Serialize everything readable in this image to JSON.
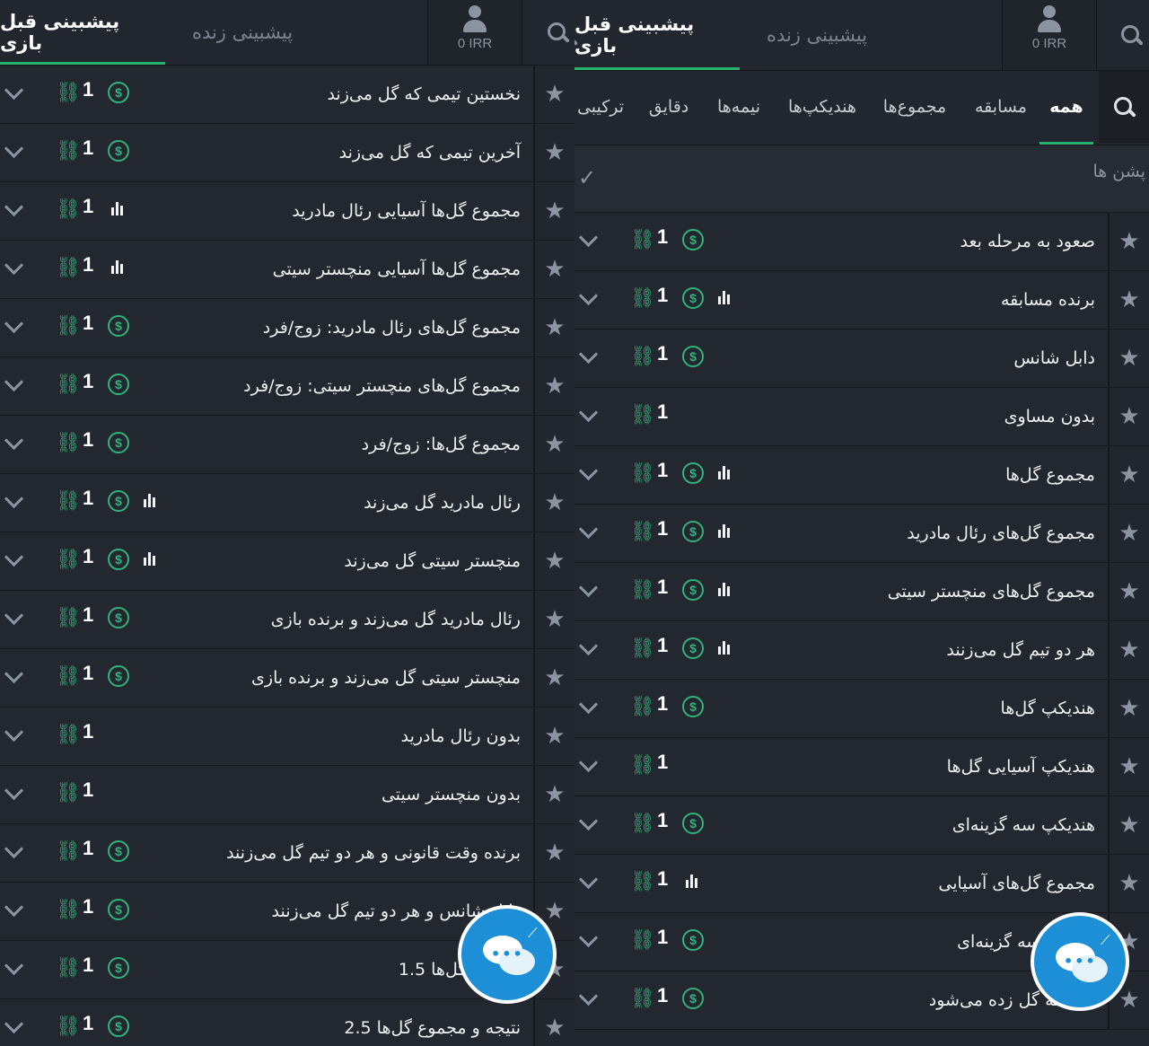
{
  "left": {
    "tabs": {
      "pre_match": "پیشبینی قبل بازی",
      "live": "پیشبینی زنده"
    },
    "wallet": {
      "balance": "0 IRR",
      "icon": "user-icon"
    },
    "rows": [
      {
        "name": "نخستین تیمی که گل می‌زند",
        "count": "1",
        "dollar": true,
        "stats": false
      },
      {
        "name": "آخرین تیمی که گل می‌زند",
        "count": "1",
        "dollar": true,
        "stats": false
      },
      {
        "name": "مجموع گل‌ها آسیایی رئال مادرید",
        "count": "1",
        "dollar": false,
        "stats": true
      },
      {
        "name": "مجموع گل‌ها آسیایی منچستر سیتی",
        "count": "1",
        "dollar": false,
        "stats": true
      },
      {
        "name": "مجموع گل‌های رئال مادرید: زوج/فرد",
        "count": "1",
        "dollar": true,
        "stats": false
      },
      {
        "name": "مجموع گل‌های منچستر سیتی: زوج/فرد",
        "count": "1",
        "dollar": true,
        "stats": false
      },
      {
        "name": "مجموع گل‌ها: زوج/فرد",
        "count": "1",
        "dollar": true,
        "stats": false
      },
      {
        "name": "رئال مادرید گل می‌زند",
        "count": "1",
        "dollar": true,
        "stats": true
      },
      {
        "name": "منچستر سیتی گل می‌زند",
        "count": "1",
        "dollar": true,
        "stats": true
      },
      {
        "name": "رئال مادرید گل می‌زند و برنده بازی",
        "count": "1",
        "dollar": true,
        "stats": false
      },
      {
        "name": "منچستر سیتی گل می‌زند و برنده بازی",
        "count": "1",
        "dollar": true,
        "stats": false
      },
      {
        "name": "بدون رئال مادرید",
        "count": "1",
        "dollar": false,
        "stats": false
      },
      {
        "name": "بدون منچستر سیتی",
        "count": "1",
        "dollar": false,
        "stats": false
      },
      {
        "name": "برنده وقت قانونی و هر دو تیم گل می‌زنند",
        "count": "1",
        "dollar": true,
        "stats": false
      },
      {
        "name": "دابل شانس و هر دو تیم گل می‌زنند",
        "count": "1",
        "dollar": true,
        "stats": false
      },
      {
        "name": "مجموع گل‌ها 1.5",
        "count": "1",
        "dollar": true,
        "stats": false
      },
      {
        "name": "نتیجه و مجموع گل‌ها 2.5",
        "count": "1",
        "dollar": true,
        "stats": false
      }
    ]
  },
  "right": {
    "tabs": {
      "pre_match": "پیشبینی قبل بازی",
      "live": "پیشبینی زنده"
    },
    "wallet": {
      "balance": "0 IRR",
      "icon": "user-icon"
    },
    "filters": [
      "همه",
      "مسابقه",
      "مجموع‌ها",
      "هندیکپ‌ها",
      "نیمه‌ها",
      "دقایق",
      "ترکیبی"
    ],
    "active_filter": "همه",
    "options_label": "پشن ها",
    "rows": [
      {
        "name": "صعود به مرحله بعد",
        "count": "1",
        "dollar": true,
        "stats": false
      },
      {
        "name": "برنده مسابقه",
        "count": "1",
        "dollar": true,
        "stats": true
      },
      {
        "name": "دابل شانس",
        "count": "1",
        "dollar": true,
        "stats": false
      },
      {
        "name": "بدون مساوی",
        "count": "1",
        "dollar": false,
        "stats": false
      },
      {
        "name": "مجموع گل‌ها",
        "count": "1",
        "dollar": true,
        "stats": true
      },
      {
        "name": "مجموع گل‌های رئال مادرید",
        "count": "1",
        "dollar": true,
        "stats": true
      },
      {
        "name": "مجموع گل‌های منچستر سیتی",
        "count": "1",
        "dollar": true,
        "stats": true
      },
      {
        "name": "هر دو تیم گل می‌زنند",
        "count": "1",
        "dollar": true,
        "stats": true
      },
      {
        "name": "هندیکپ گل‌ها",
        "count": "1",
        "dollar": true,
        "stats": false
      },
      {
        "name": "هندیکپ آسیایی گل‌ها",
        "count": "1",
        "dollar": false,
        "stats": false
      },
      {
        "name": "هندیکپ سه گزینه‌ای",
        "count": "1",
        "dollar": true,
        "stats": false
      },
      {
        "name": "مجموع گل‌های آسیایی",
        "count": "1",
        "dollar": false,
        "stats": true
      },
      {
        "name": "گل‌ها – سه گزینه‌ای",
        "count": "1",
        "dollar": true,
        "stats": false
      },
      {
        "name": "دو نیمه گل زده می‌شود",
        "count": "1",
        "dollar": true,
        "stats": false
      }
    ]
  },
  "colors": {
    "background": "#22262e",
    "accent": "#26b36b",
    "icon_green": "#33b27a",
    "chat_blue": "#1c8fd6"
  },
  "icons": {
    "search": "search-icon",
    "star": "star-icon",
    "link": "link-icon",
    "dollar": "dollar-icon",
    "stats": "stats-icon",
    "chevron": "chevron-down-icon",
    "chat": "chat-icon",
    "check": "check-icon"
  }
}
